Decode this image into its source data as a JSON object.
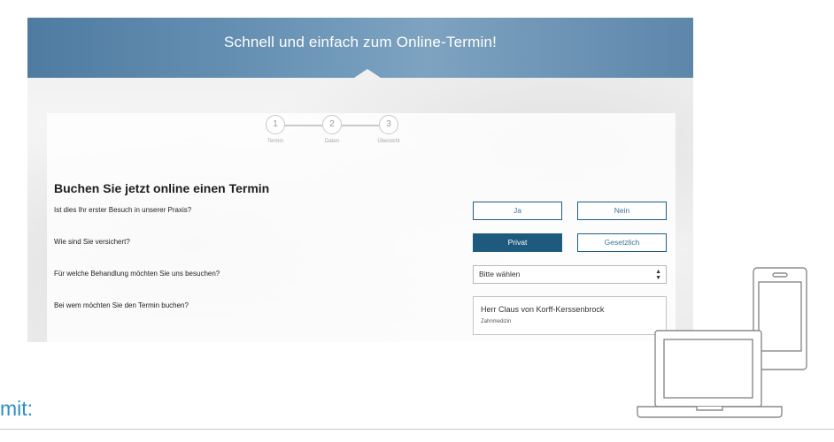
{
  "banner": {
    "title": "Schnell und einfach zum Online-Termin!"
  },
  "stepper": {
    "steps": [
      {
        "number": "1",
        "label": "Termin"
      },
      {
        "number": "2",
        "label": "Daten"
      },
      {
        "number": "3",
        "label": "Übersicht"
      }
    ]
  },
  "form": {
    "heading": "Buchen Sie jetzt online einen Termin",
    "q1": {
      "label": "Ist dies Ihr erster Besuch in unserer Praxis?",
      "yes": "Ja",
      "no": "Nein"
    },
    "q2": {
      "label": "Wie sind Sie versichert?",
      "private": "Privat",
      "public": "Gesetzlich",
      "selected": "Privat"
    },
    "q3": {
      "label": "Für welche Behandlung möchten Sie uns besuchen?",
      "select_value": "Bitte wählen"
    },
    "q4": {
      "label": "Bei wem möchten Sie den Termin buchen?",
      "doctor_name": "Herr Claus von Korff-Kerssenbrock",
      "doctor_specialty": "Zahnmedizin"
    }
  },
  "footer": {
    "mit_label": "mit:"
  },
  "colors": {
    "accent": "#1d5a7d",
    "banner": "#5d86aa",
    "link": "#2f8fc4"
  }
}
